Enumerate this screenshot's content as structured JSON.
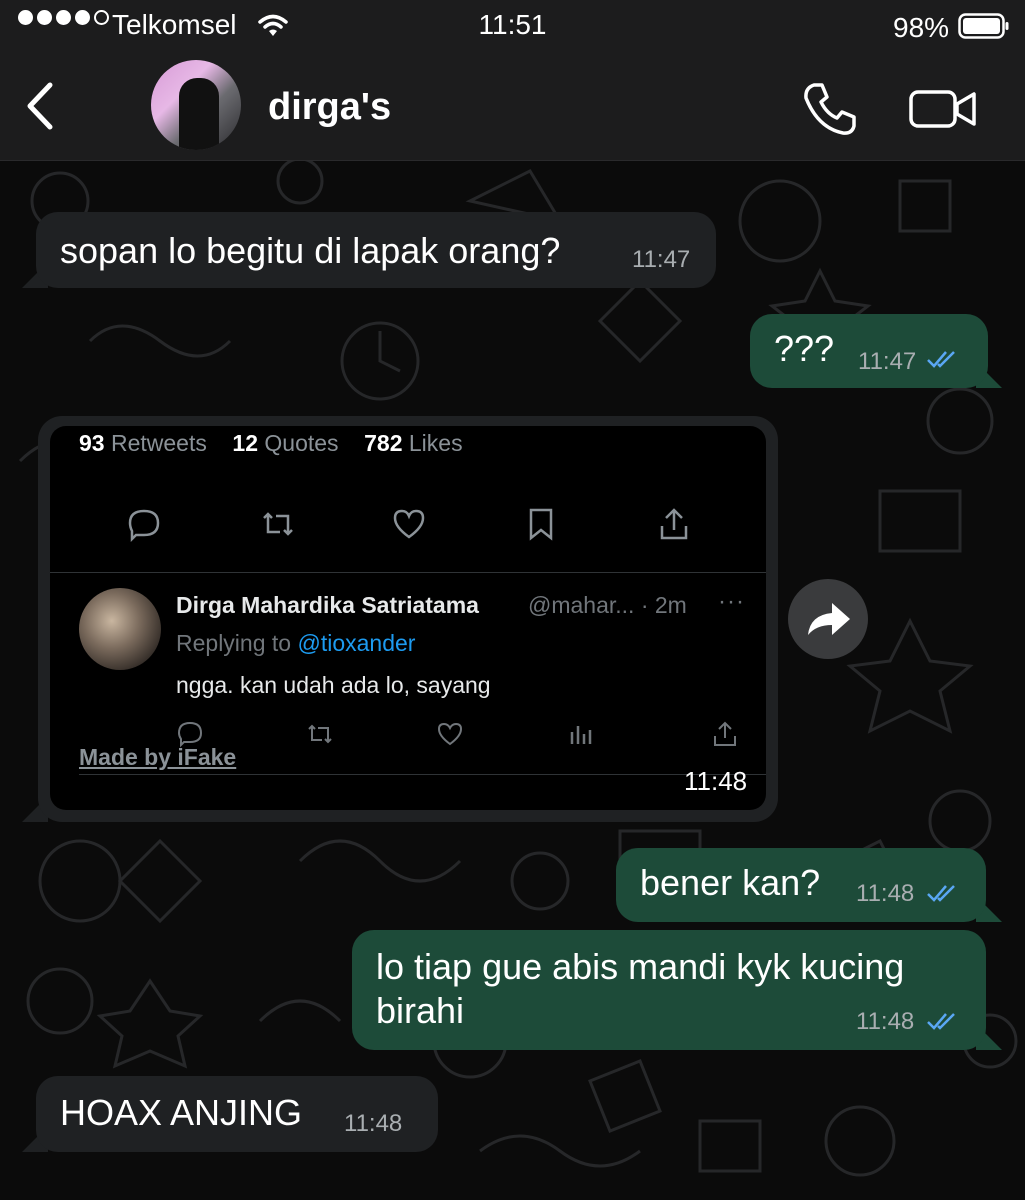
{
  "status_bar": {
    "carrier": "Telkomsel",
    "time": "11:51",
    "battery_percent": "98%",
    "signal_bars": 4,
    "battery_level": 0.98
  },
  "header": {
    "contact_name": "dirga's",
    "back_icon": "chevron-left-icon",
    "call_icon": "phone-icon",
    "video_icon": "video-camera-icon"
  },
  "messages": [
    {
      "direction": "in",
      "text": "sopan lo begitu di lapak orang?",
      "time": "11:47"
    },
    {
      "direction": "out",
      "text": "???",
      "time": "11:47",
      "status": "read"
    },
    {
      "direction": "in",
      "type": "image",
      "time": "11:48"
    },
    {
      "direction": "out",
      "text": "bener kan?",
      "time": "11:48",
      "status": "read"
    },
    {
      "direction": "out",
      "text_line1": "lo tiap gue abis mandi kyk kucing",
      "text_line2": "birahi",
      "time": "11:48",
      "status": "read"
    },
    {
      "direction": "in",
      "text": "HOAX ANJING",
      "time": "11:48"
    }
  ],
  "tweet_image": {
    "retweets_count": "93",
    "retweets_label": "Retweets",
    "quotes_count": "12",
    "quotes_label": "Quotes",
    "likes_count": "782",
    "likes_label": "Likes",
    "reply_name": "Dirga Mahardika Satriatama",
    "reply_handle": "@mahar... · 2m",
    "reply_more": "···",
    "replying_prefix": "Replying to",
    "replying_mention": "@tioxander",
    "reply_text": "ngga. kan udah ada lo, sayang",
    "watermark": "Made by iFake"
  },
  "colors": {
    "incoming_bubble": "#1f2123",
    "outgoing_bubble": "#1d4b39",
    "read_ticks": "#5aa7f4",
    "mention": "#1d9bf0"
  }
}
